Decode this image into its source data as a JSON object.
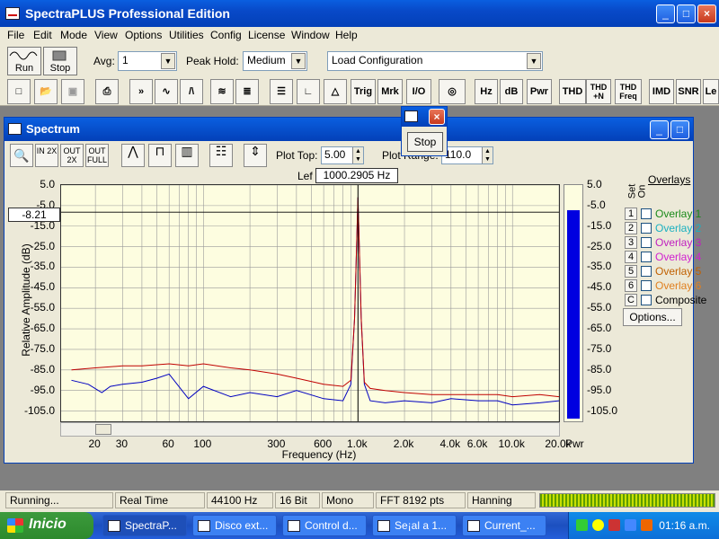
{
  "window": {
    "title": "SpectraPLUS Professional Edition",
    "minimize": "_",
    "maximize": "□",
    "close": "×"
  },
  "menu": [
    "File",
    "Edit",
    "Mode",
    "View",
    "Options",
    "Utilities",
    "Config",
    "License",
    "Window",
    "Help"
  ],
  "toolbar1": {
    "run_label": "Run",
    "stop_label": "Stop",
    "avg_label": "Avg:",
    "avg_value": "1",
    "peak_label": "Peak Hold:",
    "peak_value": "Medium",
    "config_value": "Load Configuration"
  },
  "toolbar2": [
    "Trig",
    "Mrk",
    "I/O",
    "Hz",
    "dB",
    "Pwr",
    "THD",
    "THD +N",
    "THD Freq",
    "IMD",
    "SNR",
    "Le"
  ],
  "spectrum": {
    "title": "Spectrum",
    "plot_top_label": "Plot Top:",
    "plot_top_value": "5.00",
    "plot_range_label": "Plot Range:",
    "plot_range_value": "110.0",
    "zoom_in": "IN 2X",
    "zoom_out": "OUT 2X",
    "zoom_full": "OUT FULL",
    "tooltip_prefix": "Lef",
    "tooltip_freq": "1000.2905 Hz",
    "marker_value": "-8.21",
    "y_label": "Relative Amplitude (dB)",
    "x_label": "Frequency (Hz)",
    "pwr_label": "Pwr",
    "y_ticks": [
      "5.0",
      "-5.0",
      "-15.0",
      "-25.0",
      "-35.0",
      "-45.0",
      "-55.0",
      "-65.0",
      "-75.0",
      "-85.0",
      "-95.0",
      "-105.0"
    ],
    "x_ticks": [
      "20",
      "30",
      "60",
      "100",
      "300",
      "600",
      "1.0k",
      "2.0k",
      "4.0k",
      "6.0k",
      "10.0k",
      "20.0k"
    ],
    "right_ticks": [
      "5.0",
      "-5.0",
      "-15.0",
      "-25.0",
      "-35.0",
      "-45.0",
      "-55.0",
      "-65.0",
      "-75.0",
      "-85.0",
      "-95.0",
      "-105.0"
    ],
    "overlays_title": "Overlays",
    "set_label": "Set",
    "on_label": "On",
    "overlays": [
      {
        "num": "1",
        "label": "Overlay 1",
        "color": "#1a8a1a"
      },
      {
        "num": "2",
        "label": "Overlay 2",
        "color": "#1ab0c0"
      },
      {
        "num": "3",
        "label": "Overlay 3",
        "color": "#c020c0"
      },
      {
        "num": "4",
        "label": "Overlay 4",
        "color": "#d020d0"
      },
      {
        "num": "5",
        "label": "Overlay 5",
        "color": "#c06000"
      },
      {
        "num": "6",
        "label": "Overlay 6",
        "color": "#e08020"
      },
      {
        "num": "C",
        "label": "Composite",
        "color": "#000000"
      }
    ],
    "options_label": "Options..."
  },
  "stop_popup": {
    "button": "Stop"
  },
  "status": [
    "Running...",
    "Real Time",
    "44100 Hz",
    "16 Bit",
    "Mono",
    "FFT 8192 pts",
    "Hanning"
  ],
  "taskbar": {
    "start": "Inicio",
    "tasks": [
      "SpectraP...",
      "Disco ext...",
      "Control d...",
      "Se¡al a 1...",
      "Current_..."
    ],
    "clock": "01:16 a.m."
  },
  "chart_data": {
    "type": "line",
    "xlabel": "Frequency (Hz)",
    "ylabel": "Relative Amplitude (dB)",
    "x_scale": "log",
    "xlim": [
      12,
      20000
    ],
    "ylim": [
      -110,
      5
    ],
    "series": [
      {
        "color": "#0000c0",
        "x": [
          14,
          18,
          22,
          25,
          30,
          40,
          50,
          60,
          80,
          100,
          150,
          200,
          300,
          400,
          600,
          800,
          900,
          950,
          1000,
          1050,
          1100,
          1200,
          1500,
          2000,
          3000,
          4000,
          6000,
          8000,
          10000,
          15000,
          20000
        ],
        "y": [
          -90,
          -92,
          -96,
          -93,
          -92,
          -91,
          -89,
          -87,
          -99,
          -93,
          -98,
          -96,
          -98,
          -95,
          -99,
          -100,
          -92,
          -60,
          -1,
          -60,
          -92,
          -100,
          -101,
          -100,
          -101,
          -99,
          -100,
          -100,
          -102,
          -101,
          -100
        ]
      },
      {
        "color": "#c00000",
        "x": [
          14,
          20,
          30,
          40,
          60,
          80,
          100,
          150,
          200,
          300,
          400,
          600,
          800,
          900,
          950,
          1000,
          1050,
          1100,
          1200,
          1500,
          2000,
          3000,
          4000,
          6000,
          8000,
          10000,
          15000,
          20000
        ],
        "y": [
          -85,
          -84,
          -83,
          -83,
          -82,
          -83,
          -82,
          -84,
          -85,
          -87,
          -89,
          -92,
          -93,
          -90,
          -60,
          -1,
          -60,
          -91,
          -94,
          -95,
          -96,
          -97,
          -97,
          -97,
          -97,
          -98,
          -97,
          -98
        ]
      }
    ]
  }
}
